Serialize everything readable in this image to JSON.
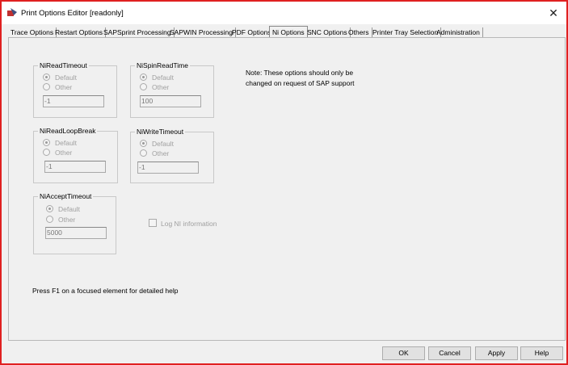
{
  "window": {
    "title": "Print Options Editor [readonly]",
    "close_icon": "close-icon"
  },
  "tabs": [
    "Trace Options",
    "Restart Options",
    "SAPSprint Processing",
    "SAPWIN Processing",
    "PDF Options",
    "Ni Options",
    "SNC Options",
    "Others",
    "Printer Tray Selection",
    "Administration"
  ],
  "selected_tab": "Ni Options",
  "groups": [
    {
      "label": "NiReadTimeout",
      "default": "Default",
      "other": "Other",
      "value": "-1"
    },
    {
      "label": "NiSpinReadTime",
      "default": "Default",
      "other": "Other",
      "value": "100"
    },
    {
      "label": "NiReadLoopBreak",
      "default": "Default",
      "other": "Other",
      "value": "-1"
    },
    {
      "label": "NiWriteTimeout",
      "default": "Default",
      "other": "Other",
      "value": "-1"
    },
    {
      "label": "NiAcceptTimeout",
      "default": "Default",
      "other": "Other",
      "value": "5000"
    }
  ],
  "log_ni": {
    "label": "Log NI information",
    "checked": false
  },
  "note": "Note: These options should only be changed on request of SAP support",
  "hint": "Press F1 on a focused element for detailed help",
  "buttons": {
    "ok": "OK",
    "cancel": "Cancel",
    "apply": "Apply",
    "help": "Help"
  },
  "colors": {
    "border": "#e02020"
  }
}
